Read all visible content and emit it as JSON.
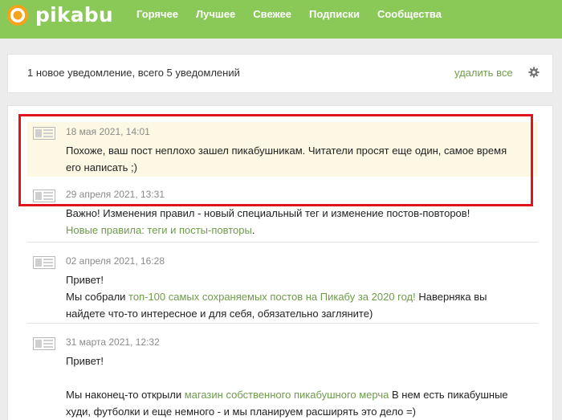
{
  "header": {
    "logo_text": "pikabu",
    "nav": [
      "Горячее",
      "Лучшее",
      "Свежее",
      "Подписки",
      "Сообщества"
    ]
  },
  "notifications_bar": {
    "summary": "1 новое уведомление, всего 5 уведомлений",
    "delete_all": "удалить все",
    "settings_icon": "gear-icon"
  },
  "items": [
    {
      "date": "18 мая 2021, 14:01",
      "text": "Похоже, ваш пост неплохо зашел пикабушникам. Читатели просят еще один, самое время его написать ;)",
      "is_new": true
    },
    {
      "date": "29 апреля 2021, 13:31",
      "text": "Важно! Изменения правил - новый специальный тег и изменение постов-повторов!",
      "link": "Новые правила: теги и посты-повторы",
      "after_link": "."
    },
    {
      "date": "02 апреля 2021, 16:28",
      "line1": "Привет!",
      "before_link": "Мы собрали ",
      "link": "топ-100 самых сохраняемых постов на Пикабу за 2020 год!",
      "after_link": " Наверняка вы найдете что-то интересное и для себя, обязательно загляните)"
    },
    {
      "date": "31 марта 2021, 12:32",
      "line1": "Привет!",
      "before_link": "Мы наконец-то открыли ",
      "link": "магазин собственного пикабушного мерча",
      "after_link": " В нем есть пикабушные худи, футболки и еще немного - и мы планируем расширять это дело =)"
    }
  ],
  "colors": {
    "header": "#8ac858",
    "link": "#6f9c4b",
    "highlight": "#fcf8e3",
    "frame": "#e0141e"
  }
}
